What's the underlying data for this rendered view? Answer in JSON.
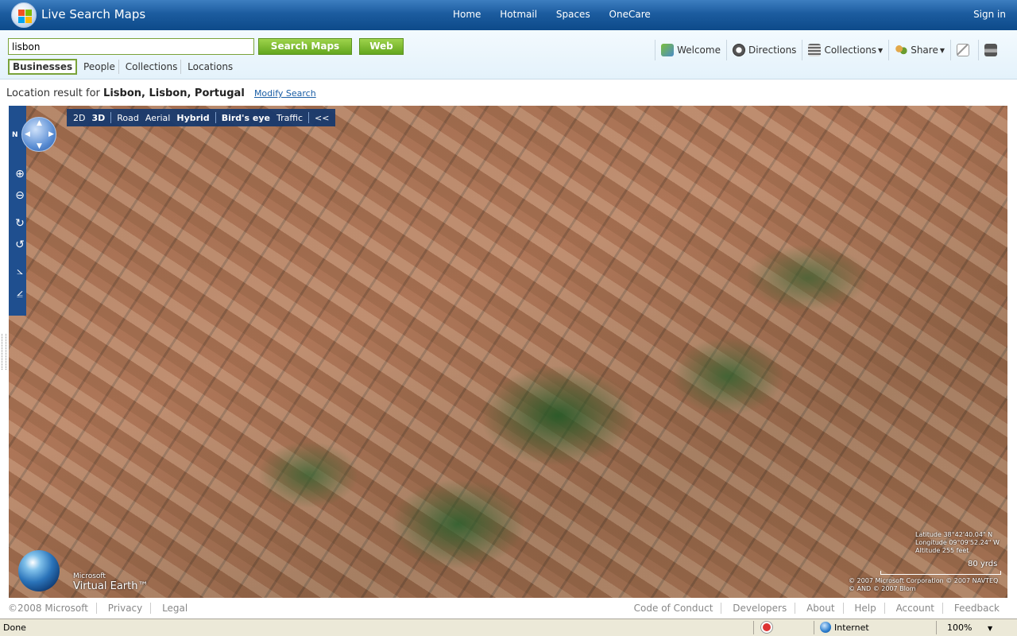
{
  "header": {
    "title": "Live Search Maps",
    "nav": [
      "Home",
      "Hotmail",
      "Spaces",
      "OneCare"
    ],
    "signin": "Sign in"
  },
  "search": {
    "query": "lisbon",
    "search_maps_label": "Search Maps",
    "web_label": "Web",
    "tabs": [
      "Businesses",
      "People",
      "Collections",
      "Locations"
    ],
    "active_tab": "Businesses"
  },
  "tools": {
    "welcome": "Welcome",
    "directions": "Directions",
    "collections": "Collections",
    "share": "Share"
  },
  "result": {
    "prefix": "Location result for",
    "location": "Lisbon, Lisbon, Portugal",
    "modify": "Modify Search"
  },
  "map": {
    "modes": {
      "d2": "2D",
      "d3": "3D",
      "road": "Road",
      "aerial": "Aerial",
      "hybrid": "Hybrid",
      "birdseye": "Bird's eye",
      "traffic": "Traffic",
      "collapse": "<<"
    },
    "north": "N",
    "latitude": "Latitude 38°42'40.04\" N",
    "longitude": "Longitude 09°09'52.24\" W",
    "altitude": "Altitude 255 feet",
    "scale": "80 yrds",
    "copyright_1": "© 2007 Microsoft Corporation  © 2007 NAVTEQ",
    "copyright_2": "© AND  © 2007 Blom",
    "ve_microsoft": "Microsoft",
    "ve_name": "Virtual Earth™"
  },
  "footer": {
    "left": [
      "©2008 Microsoft",
      "Privacy",
      "Legal"
    ],
    "right": [
      "Code of Conduct",
      "Developers",
      "About",
      "Help",
      "Account",
      "Feedback"
    ]
  },
  "status": {
    "text": "Done",
    "zone": "Internet",
    "zoom": "100%"
  }
}
